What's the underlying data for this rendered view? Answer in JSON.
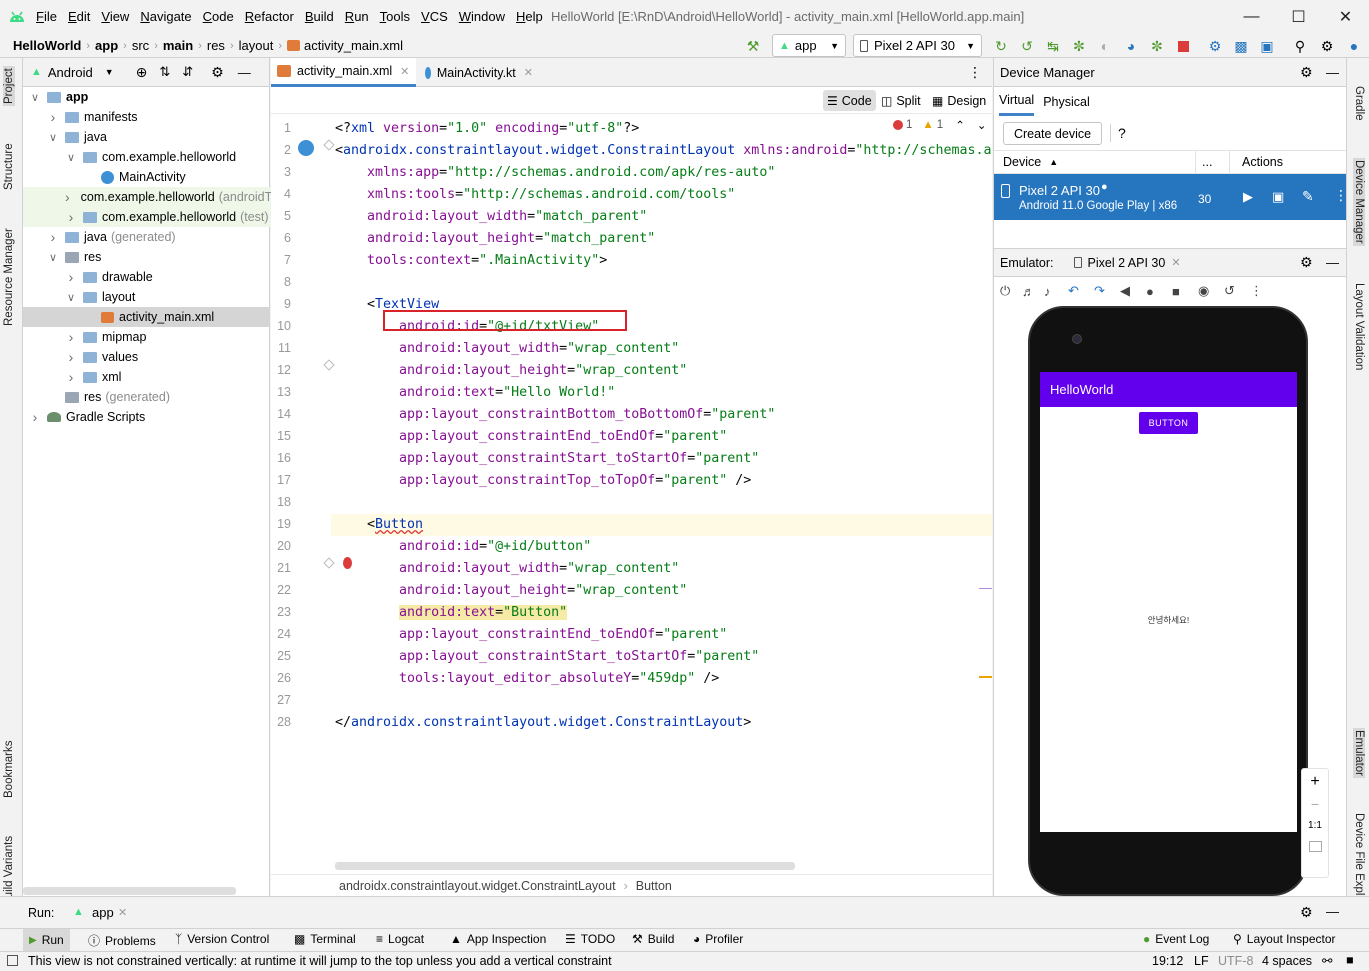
{
  "window": {
    "title": "HelloWorld [E:\\RnD\\Android\\HelloWorld] - activity_main.xml [HelloWorld.app.main]",
    "menu": [
      "File",
      "Edit",
      "View",
      "Navigate",
      "Code",
      "Refactor",
      "Build",
      "Run",
      "Tools",
      "VCS",
      "Window",
      "Help"
    ]
  },
  "breadcrumb": [
    "HelloWorld",
    "app",
    "src",
    "main",
    "res",
    "layout",
    "activity_main.xml"
  ],
  "toolbar": {
    "config": "app",
    "device": "Pixel 2 API 30"
  },
  "left_strip": [
    "Project",
    "Structure",
    "Resource Manager",
    "Bookmarks",
    "Build Variants"
  ],
  "right_strip": [
    "Gradle",
    "Device Manager",
    "Layout Validation",
    "Emulator",
    "Device File Explorer"
  ],
  "project": {
    "view": "Android",
    "tree": [
      {
        "label": "app",
        "suffix": "",
        "indent": 0,
        "arrow": "open",
        "icon": "folder",
        "bold": true
      },
      {
        "label": "manifests",
        "suffix": "",
        "indent": 1,
        "arrow": "closed",
        "icon": "folder"
      },
      {
        "label": "java",
        "suffix": "",
        "indent": 1,
        "arrow": "open",
        "icon": "folder"
      },
      {
        "label": "com.example.helloworld",
        "suffix": "",
        "indent": 2,
        "arrow": "open",
        "icon": "folder"
      },
      {
        "label": "MainActivity",
        "suffix": "",
        "indent": 3,
        "arrow": "none",
        "icon": "kotlin"
      },
      {
        "label": "com.example.helloworld",
        "suffix": "(androidTest)",
        "indent": 2,
        "arrow": "closed",
        "icon": "folder",
        "hl": true
      },
      {
        "label": "com.example.helloworld",
        "suffix": "(test)",
        "indent": 2,
        "arrow": "closed",
        "icon": "folder",
        "hl": true
      },
      {
        "label": "java",
        "suffix": "(generated)",
        "indent": 1,
        "arrow": "closed",
        "icon": "folder"
      },
      {
        "label": "res",
        "suffix": "",
        "indent": 1,
        "arrow": "open",
        "icon": "res"
      },
      {
        "label": "drawable",
        "suffix": "",
        "indent": 2,
        "arrow": "closed",
        "icon": "folder"
      },
      {
        "label": "layout",
        "suffix": "",
        "indent": 2,
        "arrow": "open",
        "icon": "folder"
      },
      {
        "label": "activity_main.xml",
        "suffix": "",
        "indent": 3,
        "arrow": "none",
        "icon": "xml",
        "selected": true
      },
      {
        "label": "mipmap",
        "suffix": "",
        "indent": 2,
        "arrow": "closed",
        "icon": "folder"
      },
      {
        "label": "values",
        "suffix": "",
        "indent": 2,
        "arrow": "closed",
        "icon": "folder"
      },
      {
        "label": "xml",
        "suffix": "",
        "indent": 2,
        "arrow": "closed",
        "icon": "folder"
      },
      {
        "label": "res",
        "suffix": "(generated)",
        "indent": 1,
        "arrow": "none",
        "icon": "res"
      },
      {
        "label": "Gradle Scripts",
        "suffix": "",
        "indent": 0,
        "arrow": "closed",
        "icon": "gradle"
      }
    ]
  },
  "editor": {
    "tabs": [
      {
        "label": "activity_main.xml",
        "active": true
      },
      {
        "label": "MainActivity.kt",
        "active": false
      }
    ],
    "view_modes": [
      "Code",
      "Split",
      "Design"
    ],
    "inspections": {
      "errors": "1",
      "warnings": "1"
    },
    "lines": [
      [
        [
          "p",
          "<?"
        ],
        [
          "t",
          "xml "
        ],
        [
          "a",
          "version"
        ],
        [
          "p",
          "="
        ],
        [
          "s",
          "\"1.0\" "
        ],
        [
          "a",
          "encoding"
        ],
        [
          "p",
          "="
        ],
        [
          "s",
          "\"utf-8\""
        ],
        [
          "p",
          "?>"
        ]
      ],
      [
        [
          "p",
          "<"
        ],
        [
          "t",
          "androidx.constraintlayout.widget.ConstraintLayout "
        ],
        [
          "a",
          "xmlns:android"
        ],
        [
          "p",
          "="
        ],
        [
          "s",
          "\"http://schemas.a"
        ]
      ],
      [
        [
          "p",
          "    "
        ],
        [
          "a",
          "xmlns:app"
        ],
        [
          "p",
          "="
        ],
        [
          "s",
          "\"http://schemas.android.com/apk/res-auto\""
        ]
      ],
      [
        [
          "p",
          "    "
        ],
        [
          "a",
          "xmlns:tools"
        ],
        [
          "p",
          "="
        ],
        [
          "s",
          "\"http://schemas.android.com/tools\""
        ]
      ],
      [
        [
          "p",
          "    "
        ],
        [
          "a",
          "android:layout_width"
        ],
        [
          "p",
          "="
        ],
        [
          "s",
          "\"match_parent\""
        ]
      ],
      [
        [
          "p",
          "    "
        ],
        [
          "a",
          "android:layout_height"
        ],
        [
          "p",
          "="
        ],
        [
          "s",
          "\"match_parent\""
        ]
      ],
      [
        [
          "p",
          "    "
        ],
        [
          "a",
          "tools:context"
        ],
        [
          "p",
          "="
        ],
        [
          "s",
          "\".MainActivity\""
        ],
        [
          "p",
          ">"
        ]
      ],
      [],
      [
        [
          "p",
          "    <"
        ],
        [
          "t",
          "TextView"
        ]
      ],
      [
        [
          "p",
          "        "
        ],
        [
          "a",
          "android:id"
        ],
        [
          "p",
          "="
        ],
        [
          "s",
          "\"@+id/txtView\""
        ]
      ],
      [
        [
          "p",
          "        "
        ],
        [
          "a",
          "android:layout_width"
        ],
        [
          "p",
          "="
        ],
        [
          "s",
          "\"wrap_content\""
        ]
      ],
      [
        [
          "p",
          "        "
        ],
        [
          "a",
          "android:layout_height"
        ],
        [
          "p",
          "="
        ],
        [
          "s",
          "\"wrap_content\""
        ]
      ],
      [
        [
          "p",
          "        "
        ],
        [
          "a",
          "android:text"
        ],
        [
          "p",
          "="
        ],
        [
          "s",
          "\"Hello World!\""
        ]
      ],
      [
        [
          "p",
          "        "
        ],
        [
          "a",
          "app:layout_constraintBottom_toBottomOf"
        ],
        [
          "p",
          "="
        ],
        [
          "s",
          "\"parent\""
        ]
      ],
      [
        [
          "p",
          "        "
        ],
        [
          "a",
          "app:layout_constraintEnd_toEndOf"
        ],
        [
          "p",
          "="
        ],
        [
          "s",
          "\"parent\""
        ]
      ],
      [
        [
          "p",
          "        "
        ],
        [
          "a",
          "app:layout_constraintStart_toStartOf"
        ],
        [
          "p",
          "="
        ],
        [
          "s",
          "\"parent\""
        ]
      ],
      [
        [
          "p",
          "        "
        ],
        [
          "a",
          "app:layout_constraintTop_toTopOf"
        ],
        [
          "p",
          "="
        ],
        [
          "s",
          "\"parent\""
        ],
        [
          "p",
          " />"
        ]
      ],
      [],
      [
        [
          "p",
          "    <"
        ],
        [
          "t",
          "Button"
        ]
      ],
      [
        [
          "p",
          "        "
        ],
        [
          "a",
          "android:id"
        ],
        [
          "p",
          "="
        ],
        [
          "s",
          "\"@+id/button\""
        ]
      ],
      [
        [
          "p",
          "        "
        ],
        [
          "a",
          "android:layout_width"
        ],
        [
          "p",
          "="
        ],
        [
          "s",
          "\"wrap_content\""
        ]
      ],
      [
        [
          "p",
          "        "
        ],
        [
          "a",
          "android:layout_height"
        ],
        [
          "p",
          "="
        ],
        [
          "s",
          "\"wrap_content\""
        ]
      ],
      [
        [
          "p",
          "        "
        ],
        [
          "a",
          "android:text"
        ],
        [
          "p",
          "="
        ],
        [
          "s",
          "\"Button\""
        ]
      ],
      [
        [
          "p",
          "        "
        ],
        [
          "a",
          "app:layout_constraintEnd_toEndOf"
        ],
        [
          "p",
          "="
        ],
        [
          "s",
          "\"parent\""
        ]
      ],
      [
        [
          "p",
          "        "
        ],
        [
          "a",
          "app:layout_constraintStart_toStartOf"
        ],
        [
          "p",
          "="
        ],
        [
          "s",
          "\"parent\""
        ]
      ],
      [
        [
          "p",
          "        "
        ],
        [
          "a",
          "tools:layout_editor_absoluteY"
        ],
        [
          "p",
          "="
        ],
        [
          "s",
          "\"459dp\""
        ],
        [
          "p",
          " />"
        ]
      ],
      [],
      [
        [
          "p",
          "</"
        ],
        [
          "t",
          "androidx.constraintlayout.widget.ConstraintLayout"
        ],
        [
          "p",
          ">"
        ]
      ]
    ],
    "breadcrumbs": [
      "androidx.constraintlayout.widget.ConstraintLayout",
      "Button"
    ]
  },
  "device_manager": {
    "title": "Device Manager",
    "tabs": [
      "Virtual",
      "Physical"
    ],
    "create_label": "Create device",
    "help": "?",
    "columns": [
      "Device",
      "...",
      "Actions"
    ],
    "device": {
      "name": "Pixel 2 API 30",
      "detail": "Android 11.0 Google Play | x86",
      "api": "30"
    }
  },
  "emulator": {
    "label": "Emulator:",
    "tab": "Pixel 2 API 30",
    "app_title": "HelloWorld",
    "button": "BUTTON",
    "text": "안녕하세요!",
    "zoom": [
      "+",
      "−",
      "1:1"
    ]
  },
  "run": {
    "label": "Run:",
    "config": "app"
  },
  "tool_windows": [
    "Run",
    "Problems",
    "Version Control",
    "Terminal",
    "Logcat",
    "App Inspection",
    "TODO",
    "Build",
    "Profiler"
  ],
  "tool_windows_right": [
    "Event Log",
    "Layout Inspector"
  ],
  "status": {
    "message": "This view is not constrained vertically: at runtime it will jump to the top unless you add a vertical constraint",
    "time": "19:12",
    "line_sep": "LF",
    "encoding": "UTF-8",
    "indent": "4 spaces"
  },
  "colors": {
    "accent": "#2675bf",
    "purple": "#6200ee",
    "err": "#db3b3b",
    "warn": "#e9a400"
  }
}
